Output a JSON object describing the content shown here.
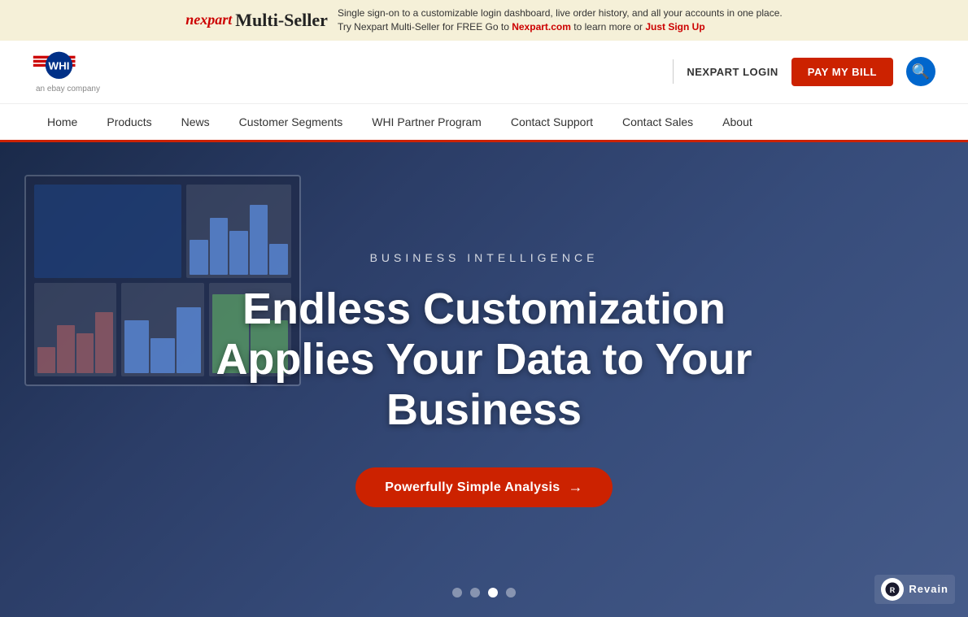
{
  "banner": {
    "logo_nexpart": "nexpart",
    "logo_multiseller": "Multi-Seller",
    "text_line1": "Single sign-on to a customizable login dashboard, live order history, and all your accounts in one place.",
    "text_line2_pre": "Try Nexpart Multi-Seller for FREE  Go to",
    "text_link": "Nexpart.com",
    "text_line2_post": "to learn more or",
    "signup_link": "Just Sign Up"
  },
  "header": {
    "logo_alt": "WHI Solutions - an eBay company",
    "ebay_sub": "an ebay company",
    "nexpart_login": "NEXPART LOGIN",
    "pay_bill": "PAY MY BILL",
    "search_icon": "search-icon"
  },
  "nav": {
    "items": [
      {
        "label": "Home",
        "id": "home"
      },
      {
        "label": "Products",
        "id": "products"
      },
      {
        "label": "News",
        "id": "news"
      },
      {
        "label": "Customer Segments",
        "id": "customer-segments"
      },
      {
        "label": "WHI Partner Program",
        "id": "whi-partner-program"
      },
      {
        "label": "Contact Support",
        "id": "contact-support"
      },
      {
        "label": "Contact Sales",
        "id": "contact-sales"
      },
      {
        "label": "About",
        "id": "about"
      }
    ]
  },
  "hero": {
    "subtitle": "BUSINESS INTELLIGENCE",
    "title": "Endless Customization Applies Your Data to Your Business",
    "cta_label": "Powerfully Simple Analysis",
    "cta_arrow": "→",
    "dots": [
      {
        "id": 1,
        "active": false
      },
      {
        "id": 2,
        "active": false
      },
      {
        "id": 3,
        "active": true
      },
      {
        "id": 4,
        "active": false
      }
    ]
  },
  "revain": {
    "icon_label": "R",
    "text": "Revain"
  }
}
